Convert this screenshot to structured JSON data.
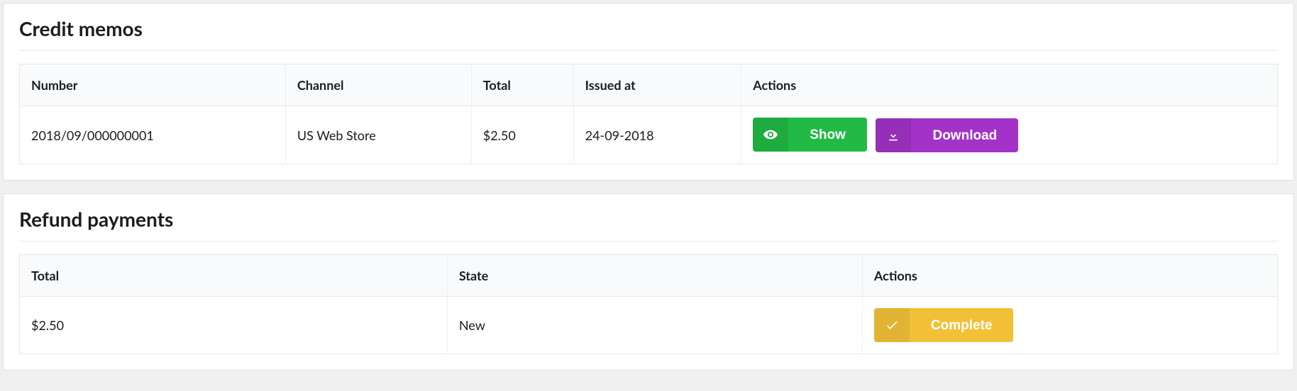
{
  "credit_memos": {
    "title": "Credit memos",
    "headers": {
      "number": "Number",
      "channel": "Channel",
      "total": "Total",
      "issued_at": "Issued at",
      "actions": "Actions"
    },
    "rows": [
      {
        "number": "2018/09/000000001",
        "channel": "US Web Store",
        "total": "$2.50",
        "issued_at": "24-09-2018"
      }
    ],
    "actions": {
      "show_label": "Show",
      "download_label": "Download"
    }
  },
  "refund_payments": {
    "title": "Refund payments",
    "headers": {
      "total": "Total",
      "state": "State",
      "actions": "Actions"
    },
    "rows": [
      {
        "total": "$2.50",
        "state": "New"
      }
    ],
    "actions": {
      "complete_label": "Complete"
    }
  },
  "colors": {
    "green": "#21ba45",
    "purple": "#a333c8",
    "yellow": "#f2c037"
  }
}
